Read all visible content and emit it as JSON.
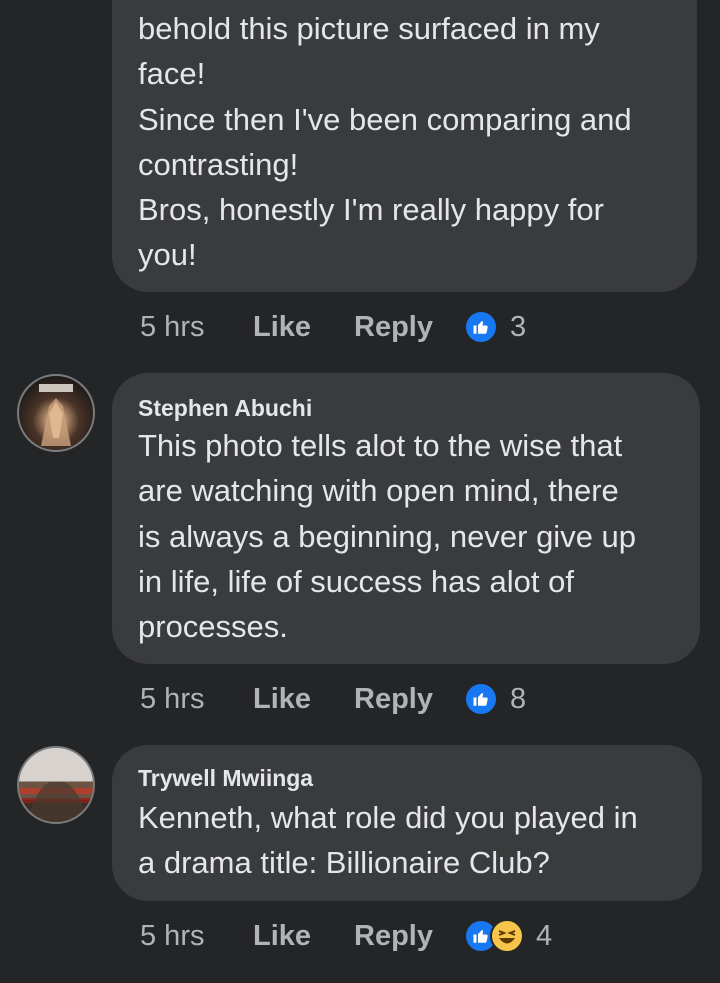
{
  "comments": [
    {
      "author": "",
      "text": "behold this picture surfaced in my\nface!\nSince then I've been comparing and\ncontrasting!\nBros, honestly I'm really happy for\nyou!",
      "time": "5 hrs",
      "like_label": "Like",
      "reply_label": "Reply",
      "reaction_count": "3",
      "reactions": [
        "like-icon"
      ]
    },
    {
      "author": "Stephen Abuchi",
      "text": "This photo tells alot to the wise that\nare watching with open mind, there\nis always a beginning, never give up\nin life, life of success has alot of\nprocesses.",
      "time": "5 hrs",
      "like_label": "Like",
      "reply_label": "Reply",
      "reaction_count": "8",
      "reactions": [
        "like-icon"
      ]
    },
    {
      "author": "Trywell Mwiinga",
      "text": "Kenneth, what role did you played in\na drama title: Billionaire Club?",
      "time": "5 hrs",
      "like_label": "Like",
      "reply_label": "Reply",
      "reaction_count": "4",
      "reactions": [
        "like-icon",
        "haha-icon"
      ]
    }
  ],
  "colors": {
    "background": "#242527",
    "bubble": "#3a3b3c",
    "text": "#e4e6eb",
    "meta": "#b0b3b8",
    "like_blue": "#1877f2",
    "haha_yellow": "#f7c54a"
  }
}
